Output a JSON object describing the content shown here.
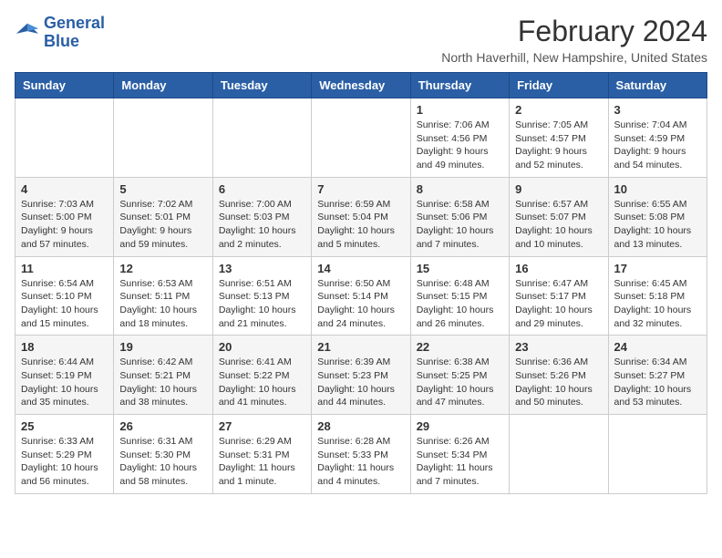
{
  "logo": {
    "line1": "General",
    "line2": "Blue"
  },
  "title": "February 2024",
  "location": "North Haverhill, New Hampshire, United States",
  "weekdays": [
    "Sunday",
    "Monday",
    "Tuesday",
    "Wednesday",
    "Thursday",
    "Friday",
    "Saturday"
  ],
  "weeks": [
    [
      {
        "day": "",
        "sunrise": "",
        "sunset": "",
        "daylight": ""
      },
      {
        "day": "",
        "sunrise": "",
        "sunset": "",
        "daylight": ""
      },
      {
        "day": "",
        "sunrise": "",
        "sunset": "",
        "daylight": ""
      },
      {
        "day": "",
        "sunrise": "",
        "sunset": "",
        "daylight": ""
      },
      {
        "day": "1",
        "sunrise": "Sunrise: 7:06 AM",
        "sunset": "Sunset: 4:56 PM",
        "daylight": "Daylight: 9 hours and 49 minutes."
      },
      {
        "day": "2",
        "sunrise": "Sunrise: 7:05 AM",
        "sunset": "Sunset: 4:57 PM",
        "daylight": "Daylight: 9 hours and 52 minutes."
      },
      {
        "day": "3",
        "sunrise": "Sunrise: 7:04 AM",
        "sunset": "Sunset: 4:59 PM",
        "daylight": "Daylight: 9 hours and 54 minutes."
      }
    ],
    [
      {
        "day": "4",
        "sunrise": "Sunrise: 7:03 AM",
        "sunset": "Sunset: 5:00 PM",
        "daylight": "Daylight: 9 hours and 57 minutes."
      },
      {
        "day": "5",
        "sunrise": "Sunrise: 7:02 AM",
        "sunset": "Sunset: 5:01 PM",
        "daylight": "Daylight: 9 hours and 59 minutes."
      },
      {
        "day": "6",
        "sunrise": "Sunrise: 7:00 AM",
        "sunset": "Sunset: 5:03 PM",
        "daylight": "Daylight: 10 hours and 2 minutes."
      },
      {
        "day": "7",
        "sunrise": "Sunrise: 6:59 AM",
        "sunset": "Sunset: 5:04 PM",
        "daylight": "Daylight: 10 hours and 5 minutes."
      },
      {
        "day": "8",
        "sunrise": "Sunrise: 6:58 AM",
        "sunset": "Sunset: 5:06 PM",
        "daylight": "Daylight: 10 hours and 7 minutes."
      },
      {
        "day": "9",
        "sunrise": "Sunrise: 6:57 AM",
        "sunset": "Sunset: 5:07 PM",
        "daylight": "Daylight: 10 hours and 10 minutes."
      },
      {
        "day": "10",
        "sunrise": "Sunrise: 6:55 AM",
        "sunset": "Sunset: 5:08 PM",
        "daylight": "Daylight: 10 hours and 13 minutes."
      }
    ],
    [
      {
        "day": "11",
        "sunrise": "Sunrise: 6:54 AM",
        "sunset": "Sunset: 5:10 PM",
        "daylight": "Daylight: 10 hours and 15 minutes."
      },
      {
        "day": "12",
        "sunrise": "Sunrise: 6:53 AM",
        "sunset": "Sunset: 5:11 PM",
        "daylight": "Daylight: 10 hours and 18 minutes."
      },
      {
        "day": "13",
        "sunrise": "Sunrise: 6:51 AM",
        "sunset": "Sunset: 5:13 PM",
        "daylight": "Daylight: 10 hours and 21 minutes."
      },
      {
        "day": "14",
        "sunrise": "Sunrise: 6:50 AM",
        "sunset": "Sunset: 5:14 PM",
        "daylight": "Daylight: 10 hours and 24 minutes."
      },
      {
        "day": "15",
        "sunrise": "Sunrise: 6:48 AM",
        "sunset": "Sunset: 5:15 PM",
        "daylight": "Daylight: 10 hours and 26 minutes."
      },
      {
        "day": "16",
        "sunrise": "Sunrise: 6:47 AM",
        "sunset": "Sunset: 5:17 PM",
        "daylight": "Daylight: 10 hours and 29 minutes."
      },
      {
        "day": "17",
        "sunrise": "Sunrise: 6:45 AM",
        "sunset": "Sunset: 5:18 PM",
        "daylight": "Daylight: 10 hours and 32 minutes."
      }
    ],
    [
      {
        "day": "18",
        "sunrise": "Sunrise: 6:44 AM",
        "sunset": "Sunset: 5:19 PM",
        "daylight": "Daylight: 10 hours and 35 minutes."
      },
      {
        "day": "19",
        "sunrise": "Sunrise: 6:42 AM",
        "sunset": "Sunset: 5:21 PM",
        "daylight": "Daylight: 10 hours and 38 minutes."
      },
      {
        "day": "20",
        "sunrise": "Sunrise: 6:41 AM",
        "sunset": "Sunset: 5:22 PM",
        "daylight": "Daylight: 10 hours and 41 minutes."
      },
      {
        "day": "21",
        "sunrise": "Sunrise: 6:39 AM",
        "sunset": "Sunset: 5:23 PM",
        "daylight": "Daylight: 10 hours and 44 minutes."
      },
      {
        "day": "22",
        "sunrise": "Sunrise: 6:38 AM",
        "sunset": "Sunset: 5:25 PM",
        "daylight": "Daylight: 10 hours and 47 minutes."
      },
      {
        "day": "23",
        "sunrise": "Sunrise: 6:36 AM",
        "sunset": "Sunset: 5:26 PM",
        "daylight": "Daylight: 10 hours and 50 minutes."
      },
      {
        "day": "24",
        "sunrise": "Sunrise: 6:34 AM",
        "sunset": "Sunset: 5:27 PM",
        "daylight": "Daylight: 10 hours and 53 minutes."
      }
    ],
    [
      {
        "day": "25",
        "sunrise": "Sunrise: 6:33 AM",
        "sunset": "Sunset: 5:29 PM",
        "daylight": "Daylight: 10 hours and 56 minutes."
      },
      {
        "day": "26",
        "sunrise": "Sunrise: 6:31 AM",
        "sunset": "Sunset: 5:30 PM",
        "daylight": "Daylight: 10 hours and 58 minutes."
      },
      {
        "day": "27",
        "sunrise": "Sunrise: 6:29 AM",
        "sunset": "Sunset: 5:31 PM",
        "daylight": "Daylight: 11 hours and 1 minute."
      },
      {
        "day": "28",
        "sunrise": "Sunrise: 6:28 AM",
        "sunset": "Sunset: 5:33 PM",
        "daylight": "Daylight: 11 hours and 4 minutes."
      },
      {
        "day": "29",
        "sunrise": "Sunrise: 6:26 AM",
        "sunset": "Sunset: 5:34 PM",
        "daylight": "Daylight: 11 hours and 7 minutes."
      },
      {
        "day": "",
        "sunrise": "",
        "sunset": "",
        "daylight": ""
      },
      {
        "day": "",
        "sunrise": "",
        "sunset": "",
        "daylight": ""
      }
    ]
  ]
}
